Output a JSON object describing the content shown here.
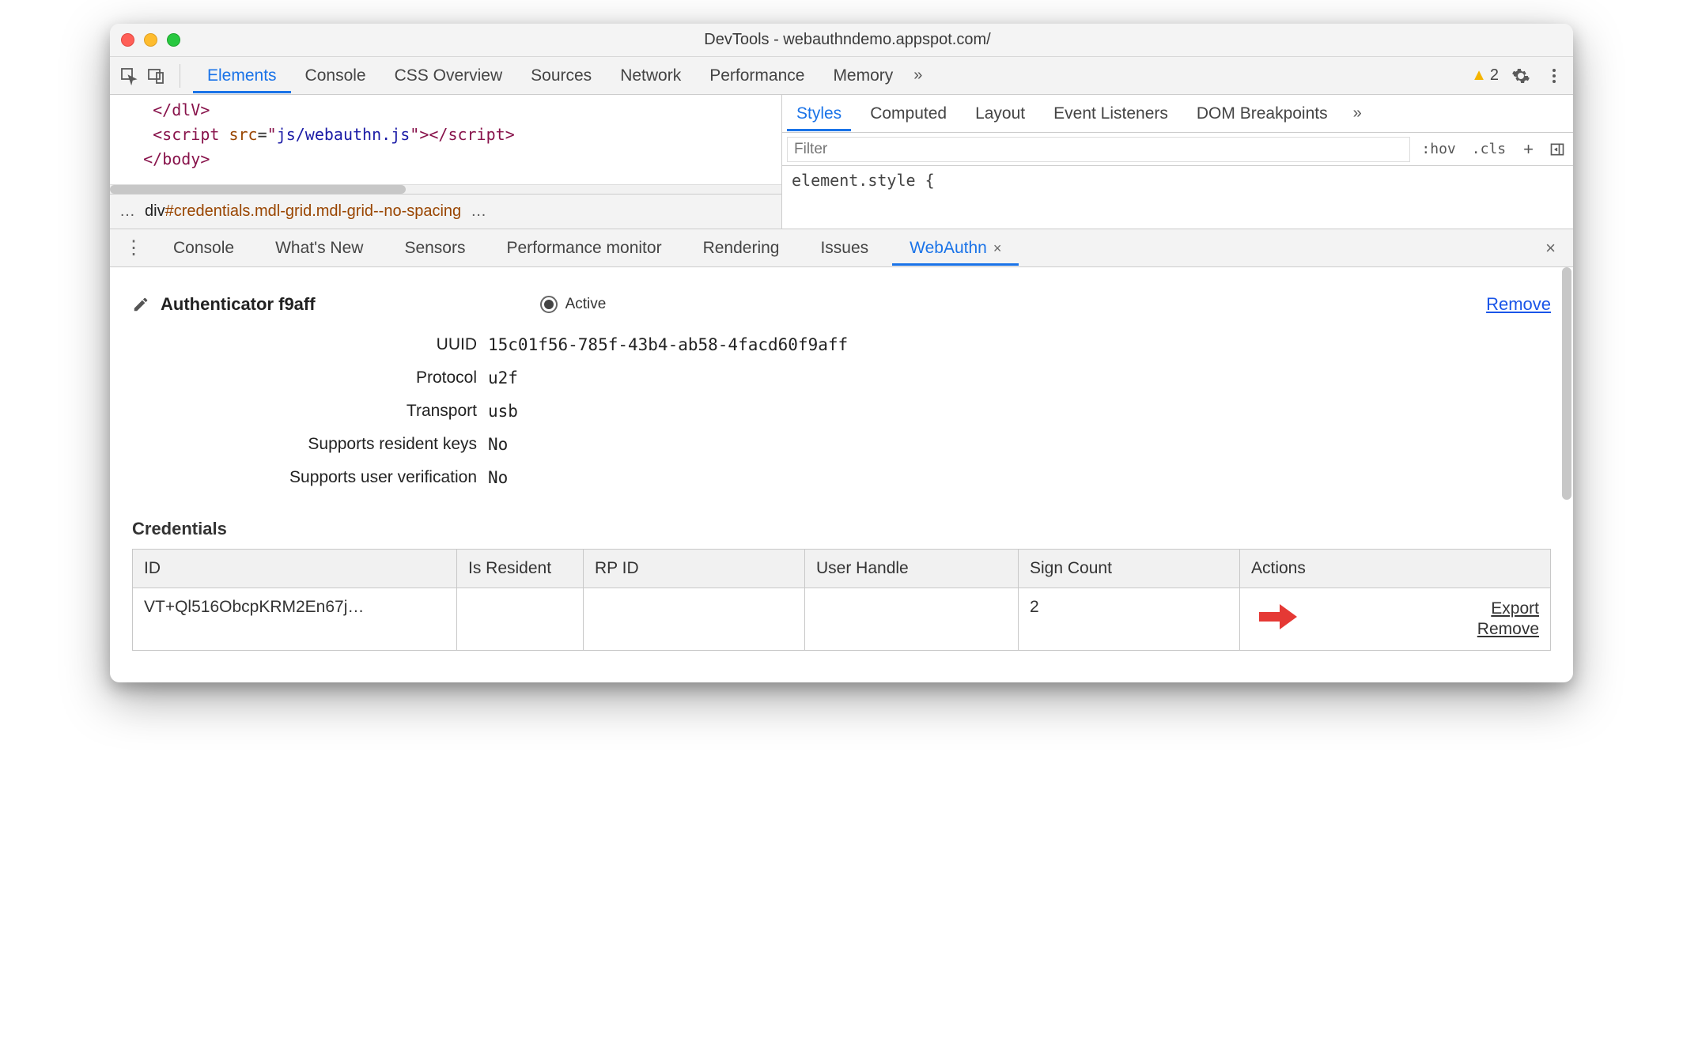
{
  "window": {
    "title": "DevTools - webauthndemo.appspot.com/"
  },
  "toolbar": {
    "tabs": [
      "Elements",
      "Console",
      "CSS Overview",
      "Sources",
      "Network",
      "Performance",
      "Memory"
    ],
    "active": "Elements",
    "warning_count": "2"
  },
  "code": {
    "lines": [
      {
        "indent": "   ",
        "open": "</",
        "tag": "dlV",
        "close": ">"
      },
      {
        "indent": "   ",
        "open": "<",
        "tag": "script",
        "attrs": [
          {
            "name": "src",
            "val": "js/webauthn.js"
          }
        ],
        "selfclose": "></",
        "closetag": "script",
        "close2": ">"
      },
      {
        "indent": "  ",
        "open": "</",
        "tag": "body",
        "close": ">"
      }
    ]
  },
  "breadcrumb": {
    "prefix": "…",
    "element": "div",
    "id": "#credentials",
    "classes": ".mdl-grid.mdl-grid--no-spacing",
    "suffix": "…"
  },
  "styles": {
    "tabs": [
      "Styles",
      "Computed",
      "Layout",
      "Event Listeners",
      "DOM Breakpoints"
    ],
    "active": "Styles",
    "filter_placeholder": "Filter",
    "hov": ":hov",
    "cls": ".cls",
    "body": "element.style {"
  },
  "drawer": {
    "tabs": [
      "Console",
      "What's New",
      "Sensors",
      "Performance monitor",
      "Rendering",
      "Issues",
      "WebAuthn"
    ],
    "active": "WebAuthn"
  },
  "auth": {
    "name": "Authenticator f9aff",
    "active_label": "Active",
    "remove_label": "Remove",
    "details": {
      "uuid_label": "UUID",
      "uuid": "15c01f56-785f-43b4-ab58-4facd60f9aff",
      "protocol_label": "Protocol",
      "protocol": "u2f",
      "transport_label": "Transport",
      "transport": "usb",
      "resident_label": "Supports resident keys",
      "resident": "No",
      "uv_label": "Supports user verification",
      "uv": "No"
    }
  },
  "credentials": {
    "title": "Credentials",
    "headers": {
      "id": "ID",
      "resident": "Is Resident",
      "rp": "RP ID",
      "user": "User Handle",
      "sign": "Sign Count",
      "actions": "Actions"
    },
    "rows": [
      {
        "id": "VT+Ql516ObcpKRM2En67j…",
        "resident": "",
        "rp": "",
        "user": "",
        "sign": "2",
        "export": "Export",
        "remove": "Remove"
      }
    ]
  }
}
